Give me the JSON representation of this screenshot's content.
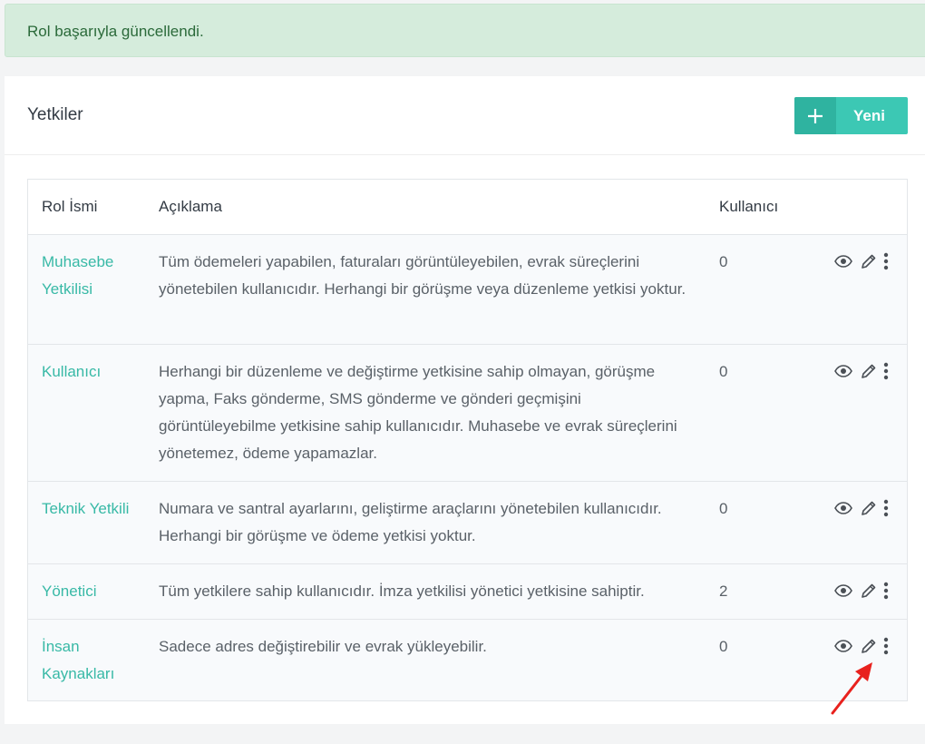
{
  "alert": {
    "message": "Rol başarıyla güncellendi."
  },
  "card": {
    "title": "Yetkiler",
    "new_button": {
      "label": "Yeni",
      "icon": "plus-icon"
    }
  },
  "table": {
    "columns": [
      "Rol İsmi",
      "Açıklama",
      "Kullanıcı",
      ""
    ],
    "rows": [
      {
        "name": "Muhasebe Yetkilisi",
        "description": "Tüm ödemeleri yapabilen, faturaları görüntüleyebilen, evrak süreçlerini yönetebilen kullanıcıdır. Herhangi bir görüşme veya düzenleme yetkisi yoktur.",
        "users": "0"
      },
      {
        "name": "Kullanıcı",
        "description": "Herhangi bir düzenleme ve değiştirme yetkisine sahip olmayan, görüşme yapma, Faks gönderme, SMS gönderme ve gönderi geçmişini görüntüleyebilme yetkisine sahip kullanıcıdır. Muhasebe ve evrak süreçlerini yönetemez, ödeme yapamazlar.",
        "users": "0"
      },
      {
        "name": "Teknik Yetkili",
        "description": "Numara ve santral ayarlarını, geliştirme araçlarını yönetebilen kullanıcıdır. Herhangi bir görüşme ve ödeme yetkisi yoktur.",
        "users": "0"
      },
      {
        "name": "Yönetici",
        "description": "Tüm yetkilere sahip kullanıcıdır. İmza yetkilisi yönetici yetkisine sahiptir.",
        "users": "2"
      },
      {
        "name": "İnsan Kaynakları",
        "description": "Sadece adres değiştirebilir ve evrak yükleyebilir.",
        "users": "0"
      }
    ],
    "row_actions": [
      "eye-icon",
      "pencil-icon",
      "more-vertical-icon"
    ]
  },
  "colors": {
    "accent": "#3cc8b4",
    "accent_dark": "#2fb3a0",
    "link": "#38b9a6",
    "alert_bg": "#d5ecdc",
    "alert_text": "#2b6a3a",
    "annotation_arrow": "#e8211d"
  }
}
